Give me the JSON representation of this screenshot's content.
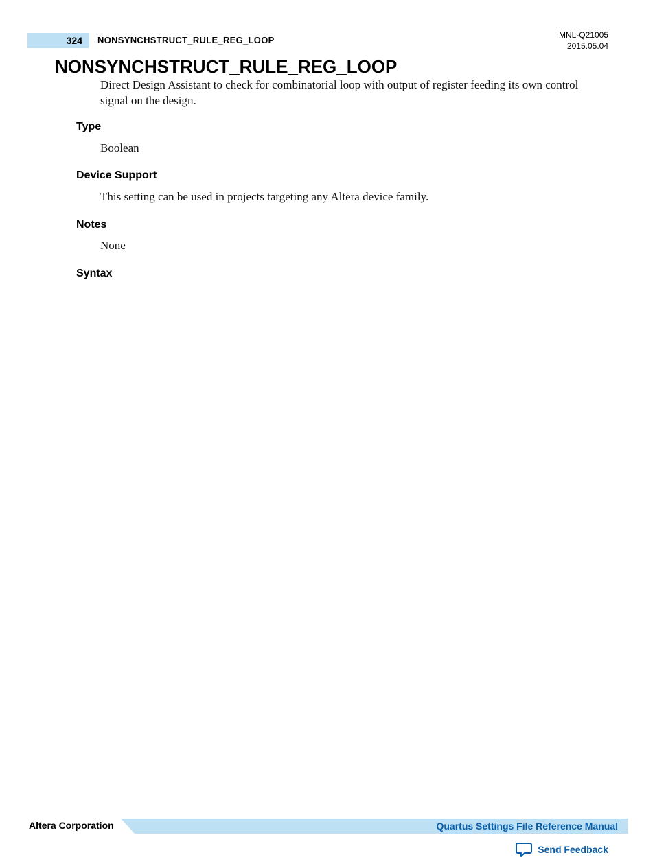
{
  "header": {
    "page_number": "324",
    "running_title": "NONSYNCHSTRUCT_RULE_REG_LOOP",
    "doc_id": "MNL-Q21005",
    "doc_date": "2015.05.04"
  },
  "main": {
    "title": "NONSYNCHSTRUCT_RULE_REG_LOOP",
    "description": "Direct Design Assistant to check for combinatorial loop with output of register feeding its own control signal on the design.",
    "sections": {
      "type": {
        "label": "Type",
        "value": "Boolean"
      },
      "device_support": {
        "label": "Device Support",
        "value": "This setting can be used in projects targeting any Altera device family."
      },
      "notes": {
        "label": "Notes",
        "value": "None"
      },
      "syntax": {
        "label": "Syntax"
      }
    }
  },
  "footer": {
    "corporation": "Altera Corporation",
    "manual_link": "Quartus Settings File Reference Manual",
    "feedback": "Send Feedback"
  },
  "colors": {
    "accent_bg": "#bde0f5",
    "link": "#0a5ea8"
  }
}
